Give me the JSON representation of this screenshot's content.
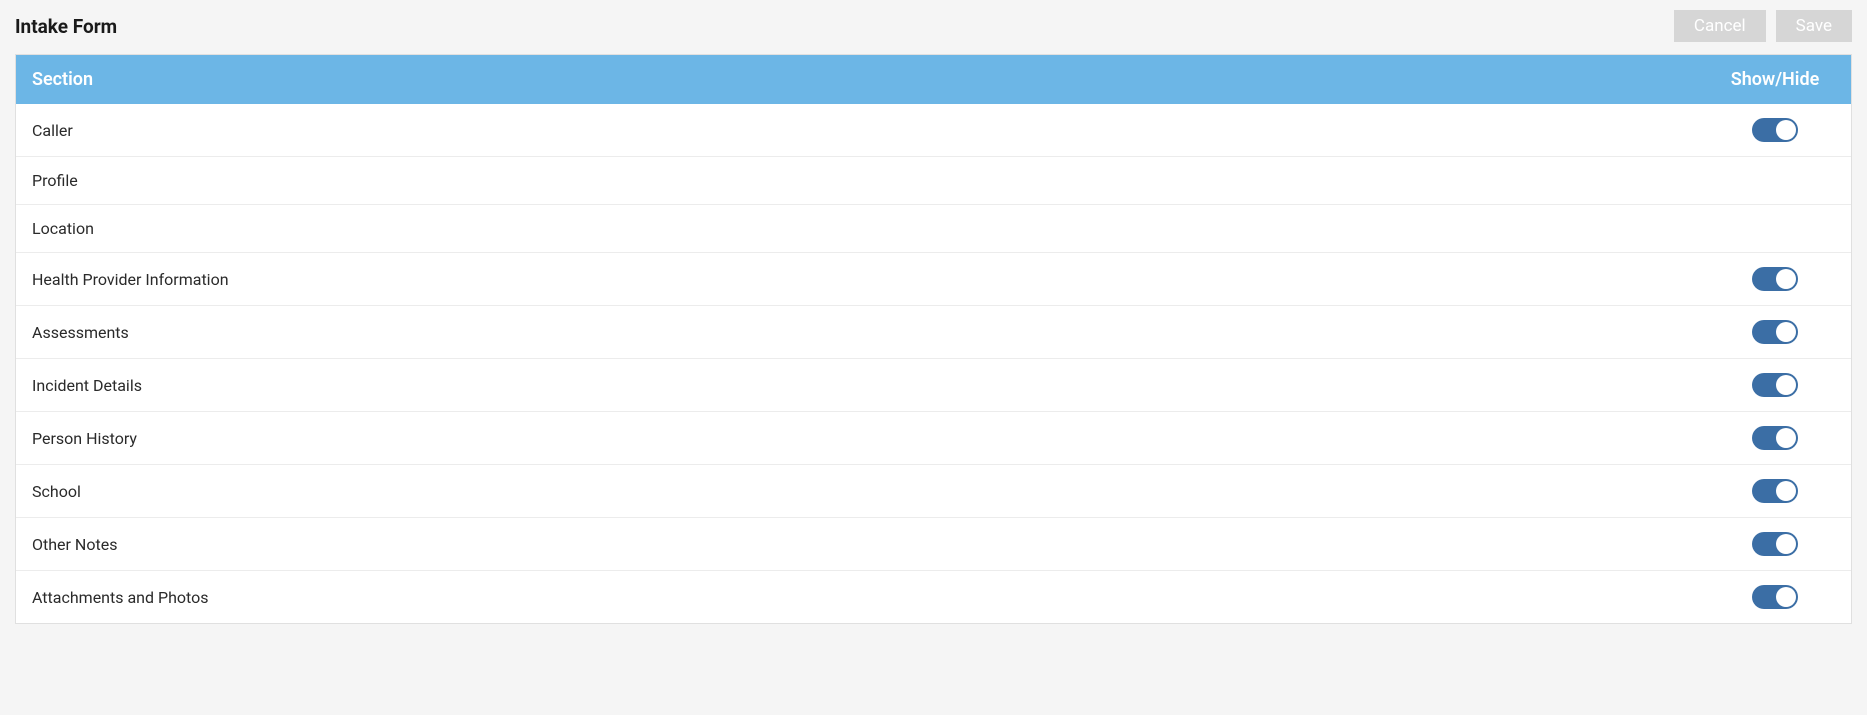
{
  "page": {
    "title": "Intake Form"
  },
  "buttons": {
    "cancel_label": "Cancel",
    "save_label": "Save"
  },
  "table": {
    "header_section": "Section",
    "header_showhide": "Show/Hide",
    "rows": [
      {
        "label": "Caller",
        "toggle": "on"
      },
      {
        "label": "Profile",
        "toggle": "none"
      },
      {
        "label": "Location",
        "toggle": "none"
      },
      {
        "label": "Health Provider Information",
        "toggle": "on"
      },
      {
        "label": "Assessments",
        "toggle": "on"
      },
      {
        "label": "Incident Details",
        "toggle": "on"
      },
      {
        "label": "Person History",
        "toggle": "on"
      },
      {
        "label": "School",
        "toggle": "on"
      },
      {
        "label": "Other Notes",
        "toggle": "on"
      },
      {
        "label": "Attachments and Photos",
        "toggle": "on"
      }
    ]
  }
}
